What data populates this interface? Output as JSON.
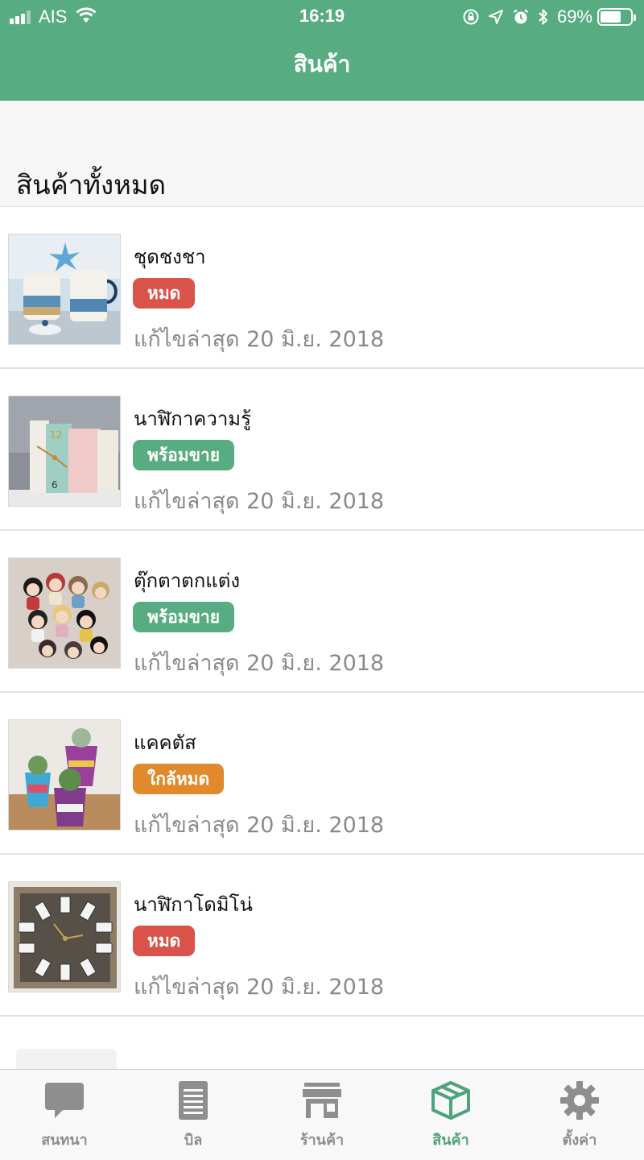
{
  "status_bar": {
    "carrier": "AIS",
    "time": "16:19",
    "battery_text": "69%",
    "battery_level": 0.69
  },
  "nav": {
    "title": "สินค้า"
  },
  "section": {
    "title": "สินค้าทั้งหมด"
  },
  "products": [
    {
      "name": "ชุดชงชา",
      "status": "หมด",
      "status_color": "#d9534a",
      "updated": "แก้ไขล่าสุด 20 มิ.ย. 2018",
      "image": "tea-set-photo"
    },
    {
      "name": "นาฬิกาความรู้",
      "status": "พร้อมขาย",
      "status_color": "#58ac82",
      "updated": "แก้ไขล่าสุด 20 มิ.ย. 2018",
      "image": "book-clock-photo"
    },
    {
      "name": "ตุ๊กตาตกแต่ง",
      "status": "พร้อมขาย",
      "status_color": "#58ac82",
      "updated": "แก้ไขล่าสุด 20 มิ.ย. 2018",
      "image": "dolls-photo"
    },
    {
      "name": "แคคตัส",
      "status": "ใกล้หมด",
      "status_color": "#e08a2c",
      "updated": "แก้ไขล่าสุด 20 มิ.ย. 2018",
      "image": "cactus-photo"
    },
    {
      "name": "นาฬิกาโดมิโน่",
      "status": "หมด",
      "status_color": "#d9534a",
      "updated": "แก้ไขล่าสุด 20 มิ.ย. 2018",
      "image": "domino-clock-photo"
    }
  ],
  "tabs": [
    {
      "label": "สนทนา",
      "icon": "chat-icon",
      "active": false
    },
    {
      "label": "บิล",
      "icon": "bill-icon",
      "active": false
    },
    {
      "label": "ร้านค้า",
      "icon": "store-icon",
      "active": false
    },
    {
      "label": "สินค้า",
      "icon": "box-icon",
      "active": true
    },
    {
      "label": "ตั้งค่า",
      "icon": "gear-icon",
      "active": false
    }
  ],
  "colors": {
    "brand": "#58ac82",
    "active_tab": "#4fa37a",
    "inactive_tab": "#8e8e8e",
    "sold_out": "#d9534a",
    "available": "#58ac82",
    "low_stock": "#e08a2c"
  }
}
